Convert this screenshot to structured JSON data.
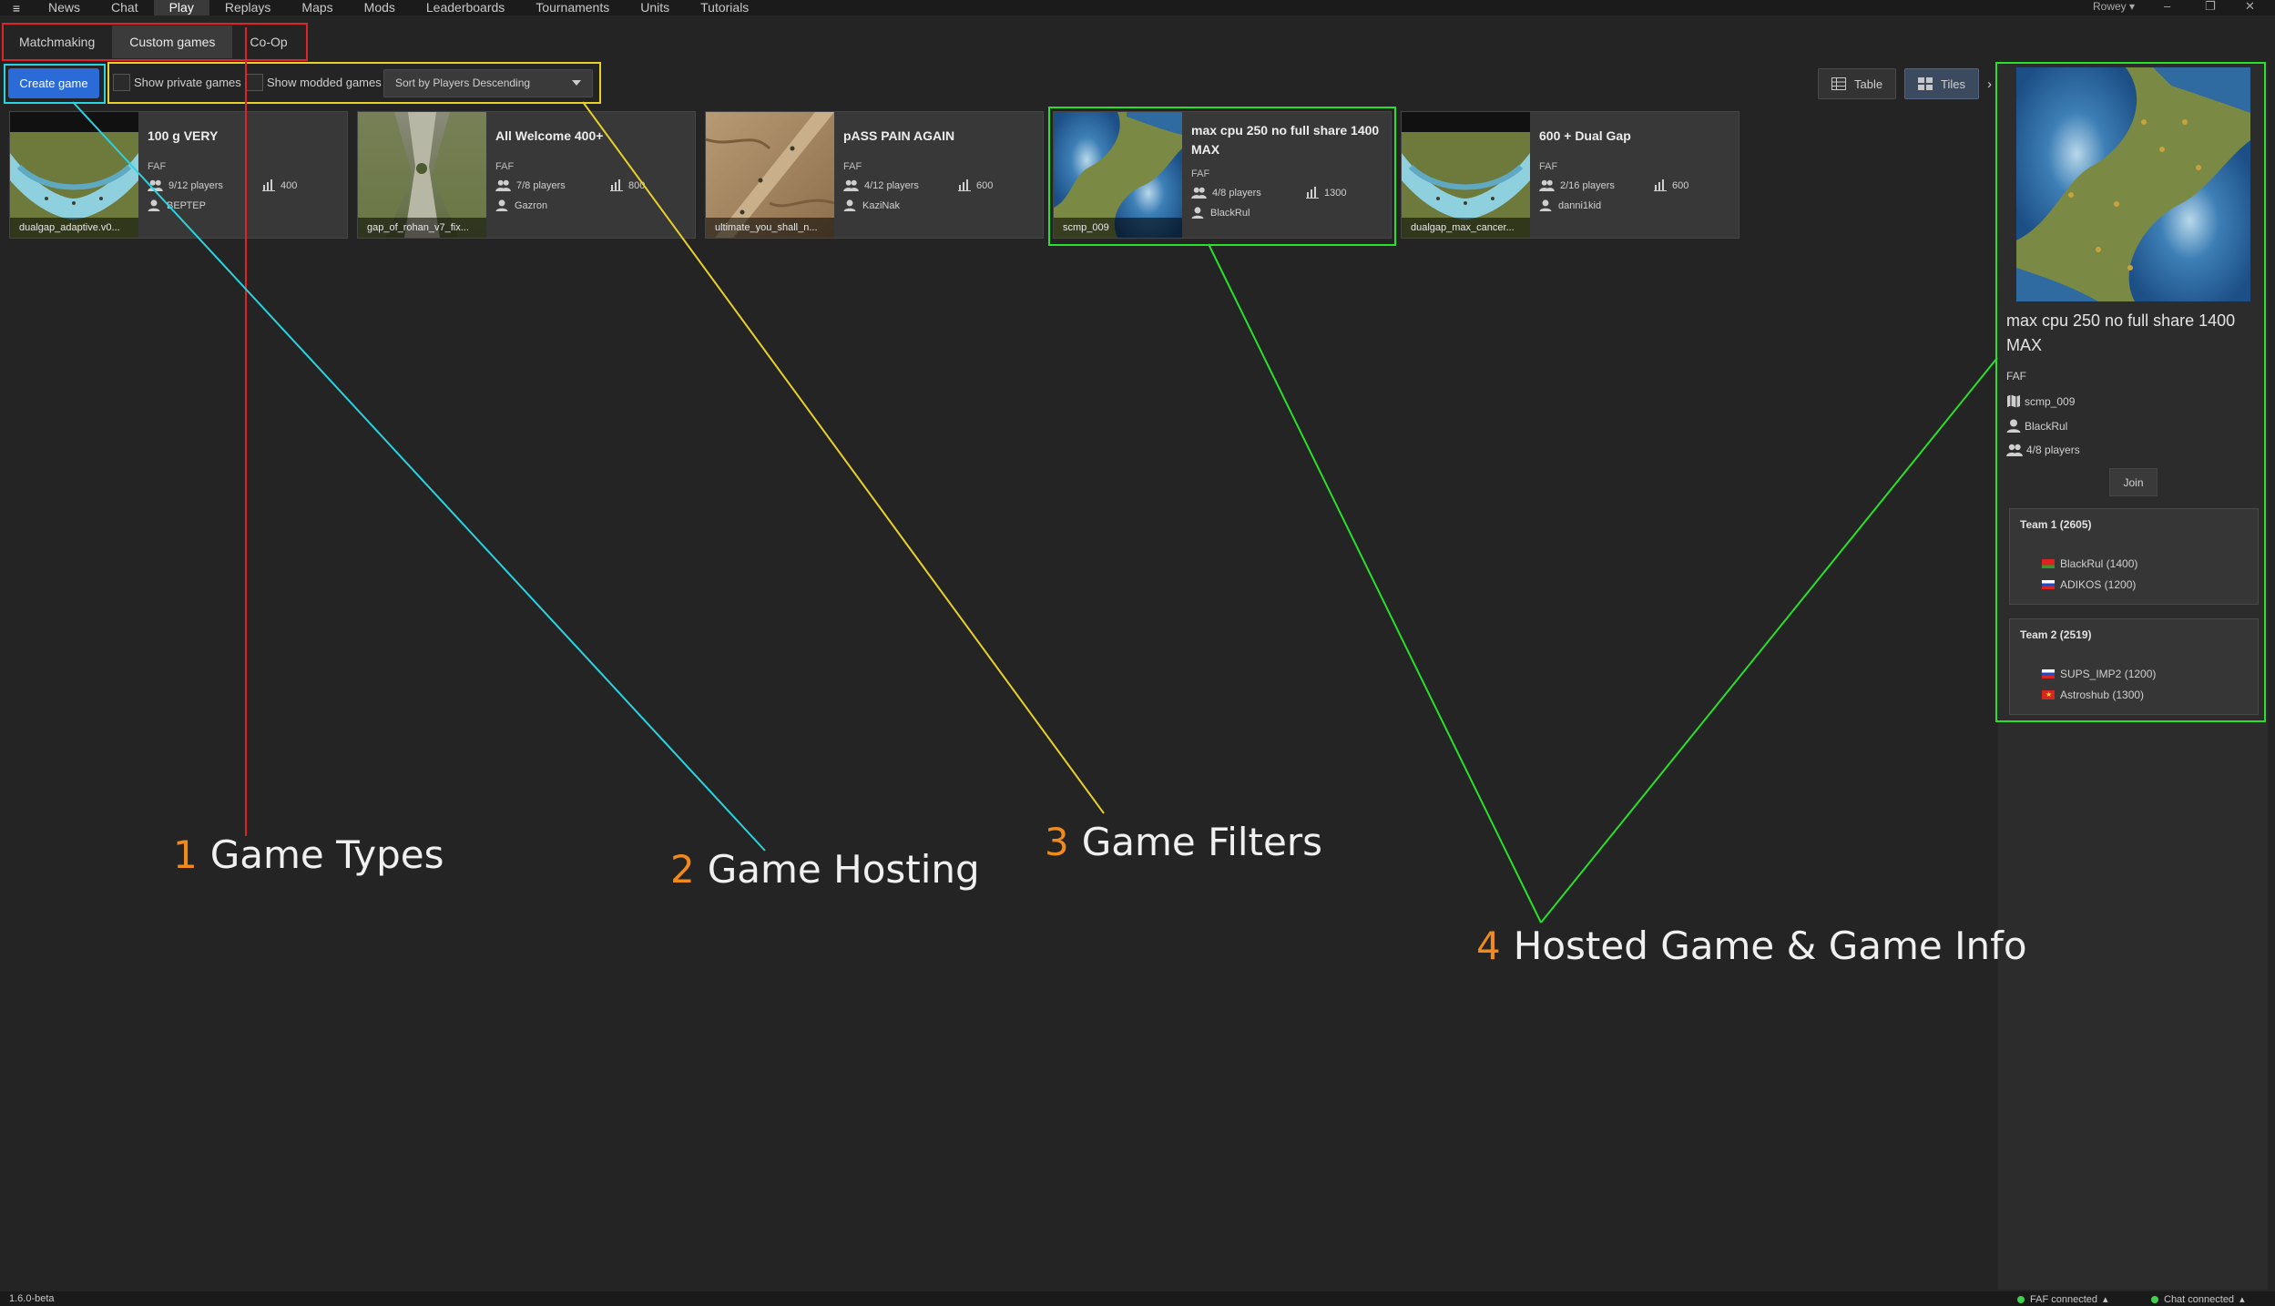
{
  "nav": {
    "items": [
      {
        "label": "News",
        "active": false
      },
      {
        "label": "Chat",
        "active": false
      },
      {
        "label": "Play",
        "active": true
      },
      {
        "label": "Replays",
        "active": false
      },
      {
        "label": "Maps",
        "active": false
      },
      {
        "label": "Mods",
        "active": false
      },
      {
        "label": "Leaderboards",
        "active": false
      },
      {
        "label": "Tournaments",
        "active": false
      },
      {
        "label": "Units",
        "active": false
      },
      {
        "label": "Tutorials",
        "active": false
      }
    ],
    "user": "Rowey"
  },
  "subtabs": [
    {
      "label": "Matchmaking",
      "active": false
    },
    {
      "label": "Custom games",
      "active": true
    },
    {
      "label": "Co-Op",
      "active": false
    }
  ],
  "toolbar": {
    "create_game": "Create game",
    "show_private": "Show private games",
    "show_modded": "Show modded games",
    "sort_value": "Sort by Players Descending",
    "view_table": "Table",
    "view_tiles": "Tiles"
  },
  "games": [
    {
      "title": "100 g VERY",
      "mod": "FAF",
      "players": "9/12 players",
      "rating": "400",
      "host": "ВЕРТЕР",
      "map": "dualgap_adaptive.v0...",
      "map_style": "dualgap"
    },
    {
      "title": "All Welcome 400+",
      "mod": "FAF",
      "players": "7/8 players",
      "rating": "800",
      "host": "Gazron",
      "map": "gap_of_rohan_v7_fix...",
      "map_style": "rohan"
    },
    {
      "title": "pASS PAIN AGAIN",
      "mod": "FAF",
      "players": "4/12 players",
      "rating": "600",
      "host": "KaziNak",
      "map": "ultimate_you_shall_n...",
      "map_style": "desert"
    },
    {
      "title": "max cpu 250 no full share 1400 MAX",
      "mod": "FAF",
      "players": "4/8 players",
      "rating": "1300",
      "host": "BlackRul",
      "map": "scmp_009",
      "map_style": "water"
    },
    {
      "title": "600 + Dual Gap",
      "mod": "FAF",
      "players": "2/16 players",
      "rating": "600",
      "host": "danni1kid",
      "map": "dualgap_max_cancer...",
      "map_style": "dualgap"
    }
  ],
  "detail": {
    "title": "max cpu 250 no full share 1400 MAX",
    "mod": "FAF",
    "map": "scmp_009",
    "host": "BlackRul",
    "players": "4/8 players",
    "join": "Join",
    "teams": [
      {
        "name": "Team 1 (2605)",
        "players": [
          {
            "name": "BlackRul (1400)",
            "flag": "by"
          },
          {
            "name": "ADIKOS (1200)",
            "flag": "ru"
          }
        ]
      },
      {
        "name": "Team 2 (2519)",
        "players": [
          {
            "name": "SUPS_IMP2 (1200)",
            "flag": "ru"
          },
          {
            "name": "Astroshub (1300)",
            "flag": "vn"
          }
        ]
      }
    ]
  },
  "annotations": [
    {
      "num": "1",
      "text": "Game Types"
    },
    {
      "num": "2",
      "text": "Game Hosting"
    },
    {
      "num": "3",
      "text": "Game Filters"
    },
    {
      "num": "4",
      "text": "Hosted Game & Game Info"
    }
  ],
  "status": {
    "version": "1.6.0-beta",
    "faf": "FAF connected",
    "chat": "Chat connected"
  },
  "colors": {
    "accent": "#2b6bd8",
    "annotation_number": "#f08a1c",
    "box_red": "#e0222a",
    "box_cyan": "#2ad4e0",
    "box_yellow": "#e7d12a",
    "box_green": "#29e02a"
  }
}
